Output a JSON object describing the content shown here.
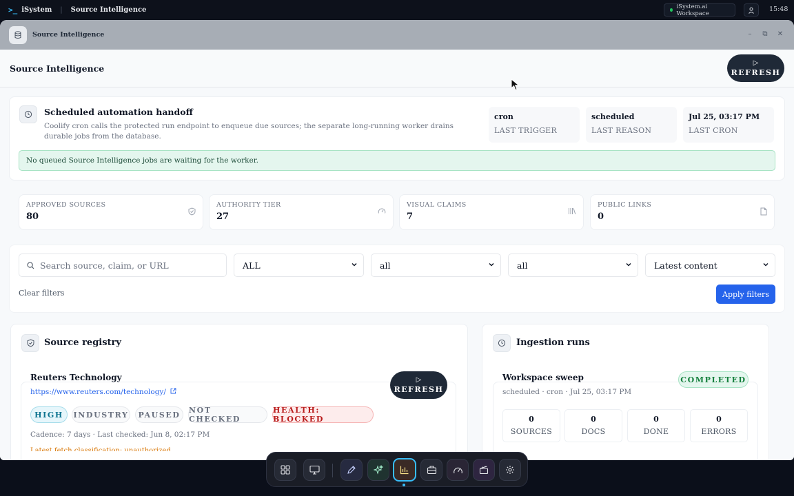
{
  "topbar": {
    "brand": "iSystem",
    "app_title": "Source Intelligence",
    "workspace": "iSystem.ai Workspace",
    "time": "15:48"
  },
  "window": {
    "title": "Source Intelligence"
  },
  "page": {
    "title": "Source Intelligence",
    "refresh_label": "REFRESH"
  },
  "automation": {
    "title": "Scheduled automation handoff",
    "description": "Coolify cron calls the protected run endpoint to enqueue due sources; the separate long-running worker drains durable jobs from the database.",
    "stats": [
      {
        "value": "cron",
        "label": "LAST TRIGGER"
      },
      {
        "value": "scheduled",
        "label": "LAST REASON"
      },
      {
        "value": "Jul 25, 03:17 PM",
        "label": "LAST CRON"
      }
    ],
    "notice": "No queued Source Intelligence jobs are waiting for the worker."
  },
  "metrics": [
    {
      "label": "APPROVED SOURCES",
      "value": "80",
      "icon": "shield-check-icon"
    },
    {
      "label": "AUTHORITY TIER",
      "value": "27",
      "icon": "gauge-icon"
    },
    {
      "label": "VISUAL CLAIMS",
      "value": "7",
      "icon": "library-icon"
    },
    {
      "label": "PUBLIC LINKS",
      "value": "0",
      "icon": "file-icon"
    }
  ],
  "filters": {
    "search_placeholder": "Search source, claim, or URL",
    "select1": "ALL",
    "select2": "all",
    "select3": "all",
    "select4": "Latest content",
    "clear_label": "Clear filters",
    "apply_label": "Apply filters"
  },
  "registry": {
    "title": "Source registry",
    "source": {
      "name": "Reuters Technology",
      "url": "https://www.reuters.com/technology/",
      "refresh_label": "REFRESH",
      "tags": [
        "HIGH",
        "INDUSTRY",
        "PAUSED",
        "NOT CHECKED",
        "HEALTH: BLOCKED"
      ],
      "cadence": "Cadence: 7 days · Last checked: Jun 8, 02:17 PM",
      "warning": "Latest fetch classification: unauthorized"
    }
  },
  "ingestion": {
    "title": "Ingestion runs",
    "run": {
      "name": "Workspace sweep",
      "subtitle": "scheduled · cron · Jul 25, 03:17 PM",
      "status": "COMPLETED",
      "stats": [
        {
          "value": "0",
          "label": "SOURCES"
        },
        {
          "value": "0",
          "label": "DOCS"
        },
        {
          "value": "0",
          "label": "DONE"
        },
        {
          "value": "0",
          "label": "ERRORS"
        }
      ]
    }
  },
  "dock": {
    "items": [
      "grid-icon",
      "monitor-icon",
      "pen-icon",
      "sparkles-icon",
      "bar-chart-icon",
      "briefcase-icon",
      "gauge-icon",
      "clapperboard-icon",
      "settings-icon"
    ]
  }
}
